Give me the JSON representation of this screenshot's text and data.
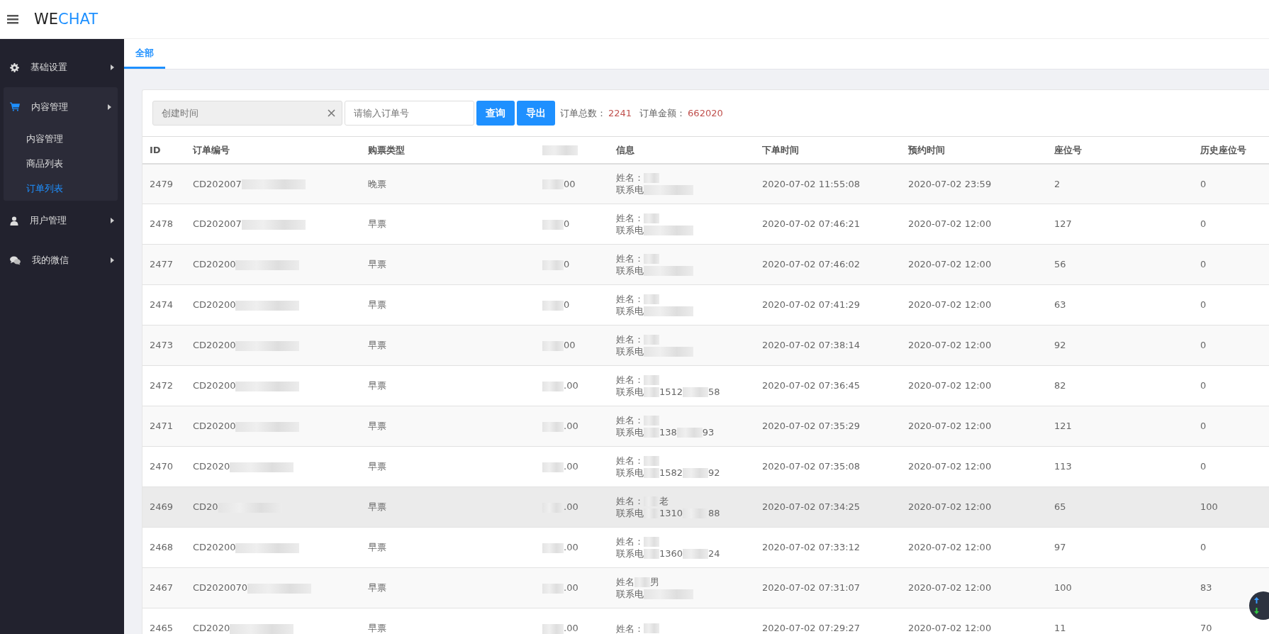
{
  "header": {
    "logo_dark": "WE",
    "logo_accent": "CHAT"
  },
  "sidebar": {
    "items": [
      {
        "label": "基础设置",
        "expanded": false
      },
      {
        "label": "内容管理",
        "expanded": true,
        "children": [
          {
            "label": "内容管理",
            "selected": false
          },
          {
            "label": "商品列表",
            "selected": false
          },
          {
            "label": "订单列表",
            "selected": true
          }
        ]
      },
      {
        "label": "用户管理",
        "expanded": false
      },
      {
        "label": "我的微信",
        "expanded": false
      }
    ]
  },
  "tabs": [
    {
      "label": "全部",
      "selected": true
    }
  ],
  "filters": {
    "date_placeholder": "创建时间",
    "order_placeholder": "请输入订单号",
    "buttons": [
      "查询",
      "导出"
    ],
    "total_label": "订单总数：",
    "total_value": "2241",
    "amount_label": "订单金额：",
    "amount_value": "662020"
  },
  "table": {
    "columns": [
      "ID",
      "订单编号",
      "购票类型",
      "",
      "信息",
      "下单时间",
      "预约时间",
      "座位号",
      "历史座位号"
    ],
    "rows": [
      {
        "id": "2479",
        "order": "CD202007",
        "type": "晚票",
        "price": "00",
        "name": "姓名：",
        "name_part": "",
        "phone": "联系电",
        "phone_parts": [],
        "ordered": "2020-07-02 11:55:08",
        "booked": "2020-07-02 23:59",
        "seat": "2",
        "history_seat": "0",
        "hovered": false
      },
      {
        "id": "2478",
        "order": "CD202007",
        "type": "早票",
        "price": "0",
        "name": "姓名：",
        "name_part": "",
        "phone": "联系电",
        "phone_parts": [],
        "ordered": "2020-07-02 07:46:21",
        "booked": "2020-07-02 12:00",
        "seat": "127",
        "history_seat": "0",
        "hovered": false
      },
      {
        "id": "2477",
        "order": "CD20200",
        "type": "早票",
        "price": "0",
        "name": "姓名：",
        "name_part": "",
        "phone": "联系电",
        "phone_parts": [],
        "ordered": "2020-07-02 07:46:02",
        "booked": "2020-07-02 12:00",
        "seat": "56",
        "history_seat": "0",
        "hovered": false
      },
      {
        "id": "2474",
        "order": "CD20200",
        "type": "早票",
        "price": "0",
        "name": "姓名：",
        "name_part": "",
        "phone": "联系电",
        "phone_parts": [],
        "ordered": "2020-07-02 07:41:29",
        "booked": "2020-07-02 12:00",
        "seat": "63",
        "history_seat": "0",
        "hovered": false
      },
      {
        "id": "2473",
        "order": "CD20200",
        "type": "早票",
        "price": "00",
        "name": "姓名：",
        "name_part": "",
        "phone": "联系电",
        "phone_parts": [],
        "ordered": "2020-07-02 07:38:14",
        "booked": "2020-07-02 12:00",
        "seat": "92",
        "history_seat": "0",
        "hovered": false
      },
      {
        "id": "2472",
        "order": "CD20200",
        "type": "早票",
        "price": ".00",
        "name": "姓名：",
        "name_part": "",
        "phone": "联系电",
        "phone_parts": [
          "1512",
          "58"
        ],
        "ordered": "2020-07-02 07:36:45",
        "booked": "2020-07-02 12:00",
        "seat": "82",
        "history_seat": "0",
        "hovered": false
      },
      {
        "id": "2471",
        "order": "CD20200",
        "type": "早票",
        "price": ".00",
        "name": "姓名：",
        "name_part": "",
        "phone": "联系电",
        "phone_parts": [
          "138",
          "93"
        ],
        "ordered": "2020-07-02 07:35:29",
        "booked": "2020-07-02 12:00",
        "seat": "121",
        "history_seat": "0",
        "hovered": false
      },
      {
        "id": "2470",
        "order": "CD2020",
        "type": "早票",
        "price": ".00",
        "name": "姓名：",
        "name_part": "",
        "phone": "联系电",
        "phone_parts": [
          "1582",
          "92"
        ],
        "ordered": "2020-07-02 07:35:08",
        "booked": "2020-07-02 12:00",
        "seat": "113",
        "history_seat": "0",
        "hovered": false
      },
      {
        "id": "2469",
        "order": "CD20",
        "type": "早票",
        "price": ".00",
        "name": "姓名：",
        "name_part": "老",
        "phone": "联系电",
        "phone_parts": [
          "1310",
          "88"
        ],
        "ordered": "2020-07-02 07:34:25",
        "booked": "2020-07-02 12:00",
        "seat": "65",
        "history_seat": "100",
        "hovered": true
      },
      {
        "id": "2468",
        "order": "CD20200",
        "type": "早票",
        "price": ".00",
        "name": "姓名：",
        "name_part": "",
        "phone": "联系电",
        "phone_parts": [
          "1360",
          "24"
        ],
        "ordered": "2020-07-02 07:33:12",
        "booked": "2020-07-02 12:00",
        "seat": "97",
        "history_seat": "0",
        "hovered": false
      },
      {
        "id": "2467",
        "order": "CD2020070",
        "type": "早票",
        "price": ".00",
        "name": "姓名",
        "name_part": "男",
        "phone": "联系电",
        "phone_parts": [],
        "ordered": "2020-07-02 07:31:07",
        "booked": "2020-07-02 12:00",
        "seat": "100",
        "history_seat": "83",
        "hovered": false
      },
      {
        "id": "2465",
        "order": "CD2020",
        "type": "早票",
        "price": ".00",
        "name": "姓名：",
        "name_part": "",
        "phone": "",
        "phone_parts": [],
        "ordered": "2020-07-02 07:29:27",
        "booked": "2020-07-02 12:00",
        "seat": "11",
        "history_seat": "70",
        "hovered": false
      }
    ]
  }
}
